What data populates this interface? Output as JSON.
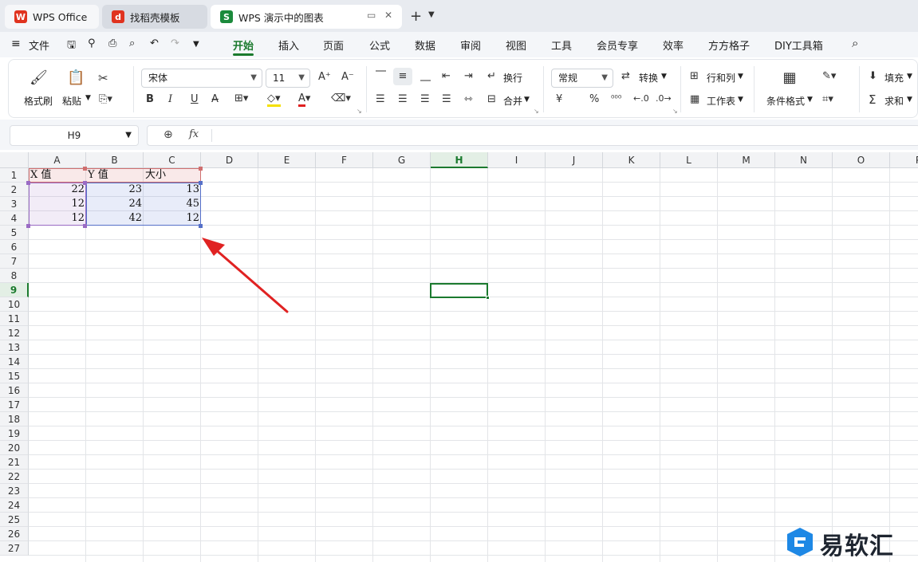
{
  "tabs": [
    {
      "label": "WPS Office",
      "logo": "W",
      "color": "#e0331f"
    },
    {
      "label": "找稻壳模板",
      "logo": "d",
      "color": "#e0331f"
    },
    {
      "label": "WPS 演示中的图表",
      "logo": "S",
      "color": "#1b8a3c"
    }
  ],
  "menu": {
    "file": "文件",
    "items": [
      "开始",
      "插入",
      "页面",
      "公式",
      "数据",
      "审阅",
      "视图",
      "工具",
      "会员专享",
      "效率",
      "方方格子",
      "DIY工具箱"
    ],
    "active": "开始"
  },
  "ribbon": {
    "format_painter": "格式刷",
    "paste": "粘贴",
    "font_name": "宋体",
    "font_size": "11",
    "wrap": "换行",
    "merge": "合并",
    "number_format": "常规",
    "convert": "转换",
    "row_col": "行和列",
    "worksheet": "工作表",
    "cond_format": "条件格式",
    "fill": "填充",
    "sum": "求和",
    "bold": "B",
    "italic": "I",
    "underline": "U",
    "font_color_glyph": "A",
    "currency": "¥",
    "percent": "%",
    "accent_color": "#1b7a2e"
  },
  "formula_bar": {
    "name_box": "H9",
    "fx": "fx"
  },
  "sheet": {
    "columns": [
      "A",
      "B",
      "C",
      "D",
      "E",
      "F",
      "G",
      "H",
      "I",
      "J",
      "K",
      "L",
      "M",
      "N",
      "O",
      "P"
    ],
    "rows": [
      "1",
      "2",
      "3",
      "4",
      "5",
      "6",
      "7",
      "8",
      "9",
      "10",
      "11",
      "12",
      "13",
      "14",
      "15",
      "16",
      "17",
      "18",
      "19",
      "20",
      "21",
      "22",
      "23",
      "24",
      "25",
      "26",
      "27"
    ],
    "selected_column": "H",
    "selected_row": "9",
    "headers": [
      "X 值",
      "Y 值",
      "大小"
    ],
    "data": [
      [
        "22",
        "23",
        "13"
      ],
      [
        "12",
        "24",
        "45"
      ],
      [
        "12",
        "42",
        "12"
      ]
    ]
  },
  "watermark": {
    "text": "易软汇"
  }
}
